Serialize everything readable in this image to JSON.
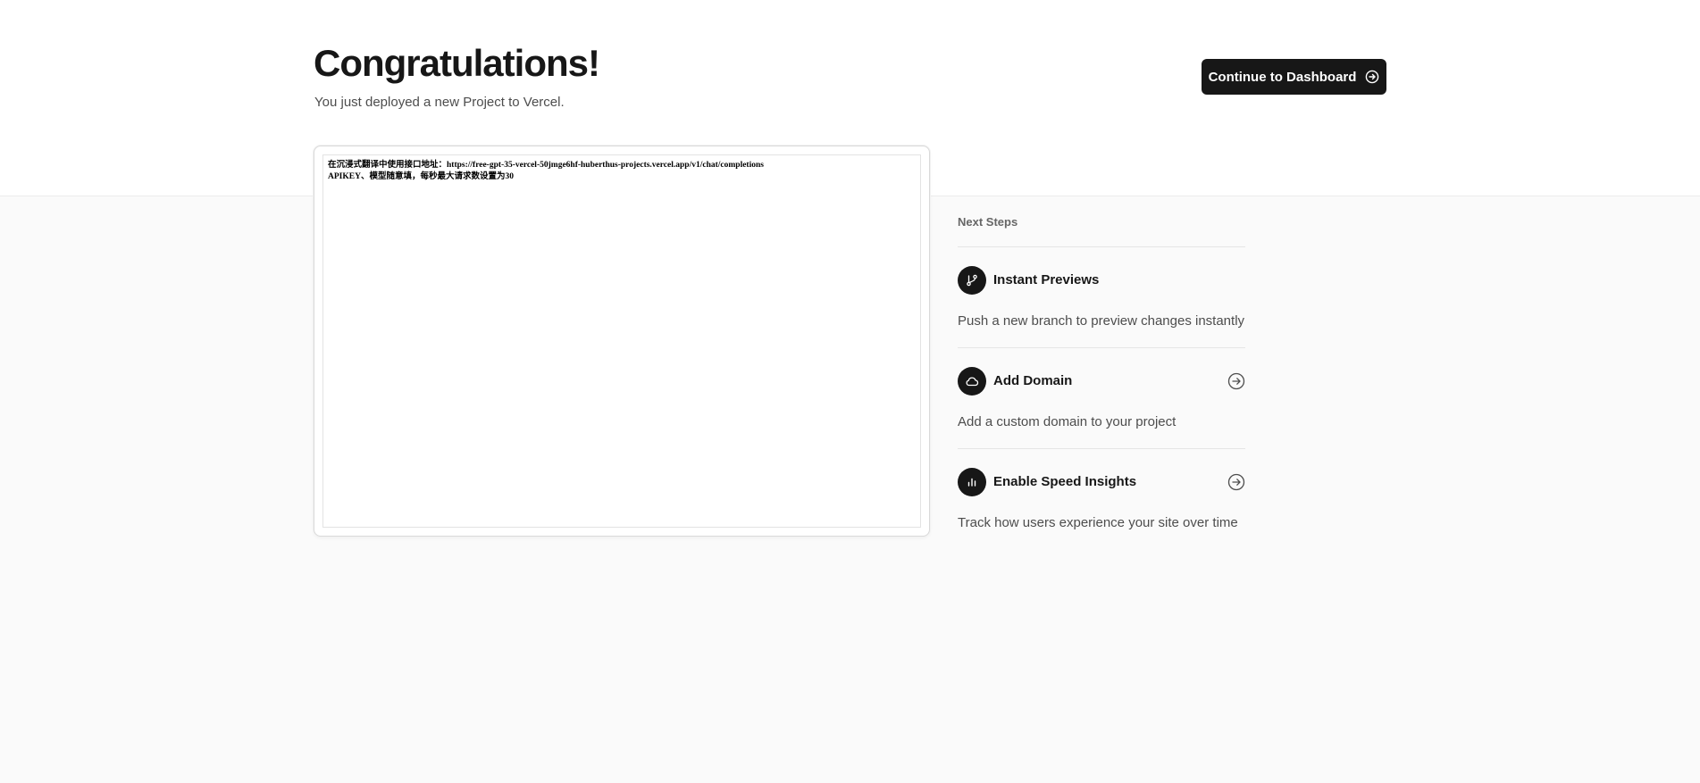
{
  "header": {
    "title": "Congratulations!",
    "subtitle": "You just deployed a new Project to Vercel.",
    "continue_label": "Continue to Dashboard"
  },
  "preview": {
    "line1": "在沉浸式翻译中使用接口地址：https://free-gpt-35-vercel-50jmge6hf-huberthus-projects.vercel.app/v1/chat/completions",
    "line2": "APIKEY、模型随意填，每秒最大请求数设置为30"
  },
  "next_steps": {
    "heading": "Next Steps",
    "items": [
      {
        "title": "Instant Previews",
        "description": "Push a new branch to preview changes instantly",
        "icon": "git-branch-icon"
      },
      {
        "title": "Add Domain",
        "description": "Add a custom domain to your project",
        "icon": "cloud-icon"
      },
      {
        "title": "Enable Speed Insights",
        "description": "Track how users experience your site over time",
        "icon": "bar-chart-icon"
      }
    ]
  },
  "colors": {
    "primary_button": "#171717",
    "page_background": "#fafafa",
    "header_background": "#ffffff"
  }
}
